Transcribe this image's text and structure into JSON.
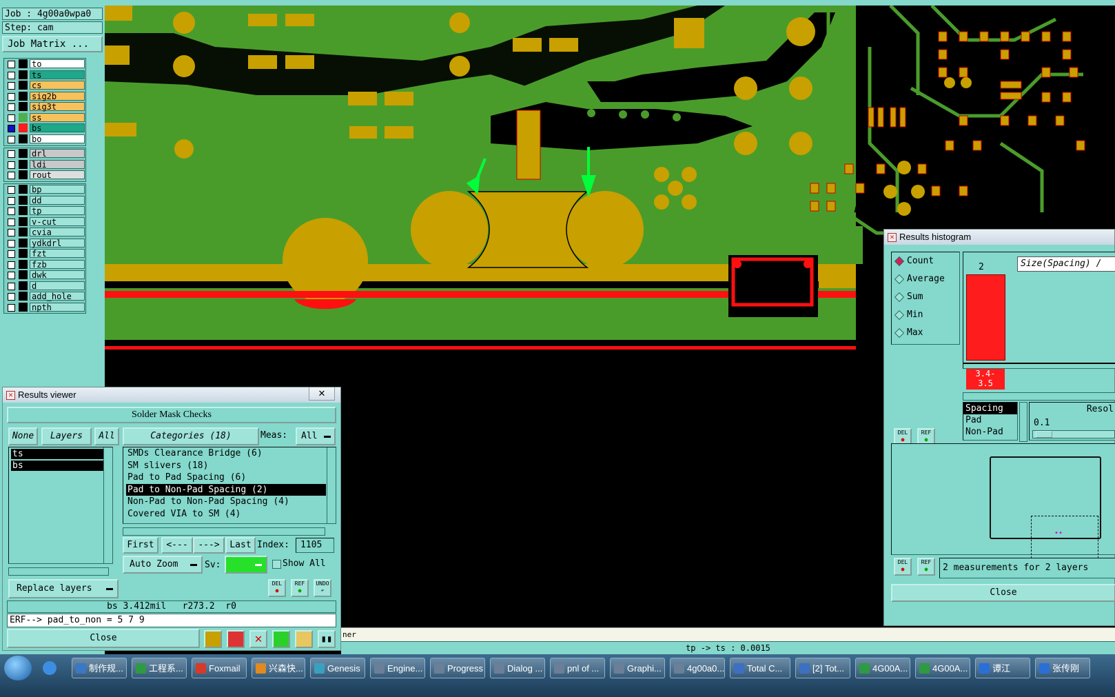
{
  "left_panel": {
    "job_label": "Job : 4g00a0wpa0",
    "step_label": "Step: cam",
    "job_matrix_button": "Job Matrix ...",
    "board_layers": [
      {
        "name": "to",
        "color": "#ffffff",
        "swatch": "#000000"
      },
      {
        "name": "ts",
        "color": "#1fa889",
        "swatch": "#000000"
      },
      {
        "name": "cs",
        "color": "#f7c15c",
        "swatch": "#000000"
      },
      {
        "name": "sig2b",
        "color": "#f7c15c",
        "swatch": "#000000"
      },
      {
        "name": "sig3t",
        "color": "#f7c15c",
        "swatch": "#000000"
      },
      {
        "name": "ss",
        "color": "#f7c15c",
        "swatch": "#4caf50"
      },
      {
        "name": "bs",
        "color": "#1fa889",
        "swatch": "#ff1c1c"
      },
      {
        "name": "bo",
        "color": "#ffffff",
        "swatch": "#000000"
      }
    ],
    "drill_layers": [
      {
        "name": "drl",
        "color": "#c8c8c8"
      },
      {
        "name": "ldi",
        "color": "#c8c8c8"
      },
      {
        "name": "rout",
        "color": "#dedede"
      }
    ],
    "misc_layers": [
      "bp",
      "dd",
      "tp",
      "v-cut",
      "cvia",
      "ydkdrl",
      "fzt",
      "fzb",
      "dwk",
      "d",
      "add_hole",
      "npth"
    ]
  },
  "results_viewer": {
    "title": "Results viewer",
    "header": "Solder Mask Checks",
    "none_button": "None",
    "layers_label": "Layers",
    "all_button": "All",
    "categories_label": "Categories (18)",
    "meas_label": "Meas:",
    "meas_value": "All",
    "layers": [
      "ts",
      "bs"
    ],
    "categories": [
      "SMDs Clearance Bridge (6)",
      "SM slivers (18)",
      "Pad to Pad Spacing (6)",
      "Pad to Non-Pad Spacing (2)",
      "Non-Pad to Non-Pad Spacing (4)",
      "Covered VIA to SM (4)"
    ],
    "selected_category_index": 3,
    "first_button": "First",
    "prev_button": "<---",
    "next_button": "--->",
    "last_button": "Last",
    "index_label": "Index:",
    "index_value": "1105",
    "auto_zoom": "Auto Zoom",
    "sv_label": "Sv:",
    "show_all": "Show All",
    "replace_layers": "Replace layers",
    "del_label": "DEL",
    "ref_label": "REF",
    "undo_label": "UNDO",
    "status_line": "bs 3.412mil   r273.2  r0",
    "erf_line": "ERF--> pad_to_non = 5 7 9",
    "close_button": "Close"
  },
  "histogram": {
    "title": "Results histogram",
    "modes": [
      "Count",
      "Average",
      "Sum",
      "Min",
      "Max"
    ],
    "selected_mode": "Count",
    "size_label": "Size(Spacing) /",
    "bar_count_label": "2",
    "bar_range_label": "3.4-\n3.5",
    "type_list": [
      "Spacing",
      "Pad",
      "Non-Pad"
    ],
    "resolution_label": "Resol",
    "resolution_value": "0.1",
    "summary": "2 measurements for 2 layers",
    "close_button": "Close",
    "del_label": "DEL",
    "ref_label": "REF"
  },
  "status_bar": {
    "message_fragment": "ner",
    "coordinate_text": "tp -> ts : 0.0015"
  },
  "taskbar": {
    "items": [
      {
        "label": "制作规...",
        "color": "#3a78c4"
      },
      {
        "label": "工程系...",
        "color": "#2e9a44"
      },
      {
        "label": "Foxmail",
        "color": "#d63a2a"
      },
      {
        "label": "兴森快...",
        "color": "#e08a22"
      },
      {
        "label": "Genesis",
        "color": "#3aa0c0"
      },
      {
        "label": "Engine...",
        "color": "#6b7f99"
      },
      {
        "label": "Progress",
        "color": "#6b7f99"
      },
      {
        "label": "Dialog ...",
        "color": "#6b7f99"
      },
      {
        "label": "pnl of ...",
        "color": "#6b7f99"
      },
      {
        "label": "Graphi...",
        "color": "#6b7f99"
      },
      {
        "label": "4g00a0...",
        "color": "#6b7f99"
      },
      {
        "label": "Total C...",
        "color": "#3d6fc2"
      },
      {
        "label": "[2] Tot...",
        "color": "#3d6fc2"
      },
      {
        "label": "4G00A...",
        "color": "#2e9a44"
      },
      {
        "label": "4G00A...",
        "color": "#2e9a44"
      },
      {
        "label": "谭江",
        "color": "#2a6fd6"
      },
      {
        "label": "张传刚",
        "color": "#2a6fd6"
      }
    ]
  }
}
